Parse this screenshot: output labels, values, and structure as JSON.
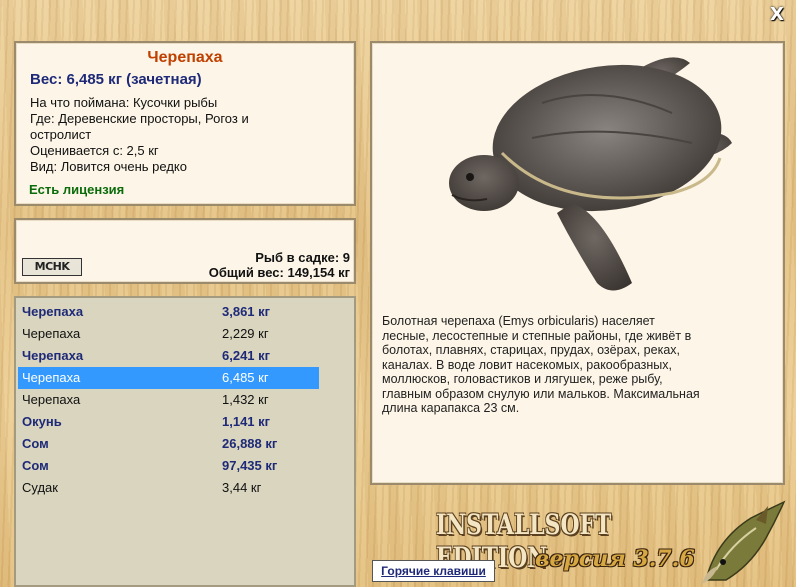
{
  "window": {
    "close_symbol": "X"
  },
  "info": {
    "title": "Черепаха",
    "weight": "Вес: 6,485 кг (зачетная)",
    "bait": "На что поймана: Кусочки рыбы",
    "where_line1": "Где: Деревенские просторы, Рогоз и",
    "where_line2": "остролист",
    "price": "Оценивается с: 2,5 кг",
    "kind": "Вид: Ловится очень редко",
    "license": "Есть лицензия"
  },
  "net": {
    "logo": "MCHK",
    "count_line": "Рыб в садке: 9",
    "total_line": "Общий вес: 149,154 кг"
  },
  "catch_list": [
    {
      "name": "Черепаха",
      "weight": "3,861 кг",
      "bold": true,
      "selected": false
    },
    {
      "name": "Черепаха",
      "weight": "2,229 кг",
      "bold": false,
      "selected": false
    },
    {
      "name": "Черепаха",
      "weight": "6,241 кг",
      "bold": true,
      "selected": false
    },
    {
      "name": "Черепаха",
      "weight": "6,485 кг",
      "bold": false,
      "selected": true
    },
    {
      "name": "Черепаха",
      "weight": "1,432 кг",
      "bold": false,
      "selected": false
    },
    {
      "name": "Окунь",
      "weight": "1,141 кг",
      "bold": true,
      "selected": false
    },
    {
      "name": "Сом",
      "weight": "26,888 кг",
      "bold": true,
      "selected": false
    },
    {
      "name": "Сом",
      "weight": "97,435 кг",
      "bold": true,
      "selected": false
    },
    {
      "name": "Судак",
      "weight": "3,44 кг",
      "bold": false,
      "selected": false
    }
  ],
  "description": {
    "lines": [
      "Болотная черепаха (Emys orbicularis) населяет",
      "лесные, лесостепные и степные районы, где живёт в",
      "болотах, плавнях, старицах, прудах, озёрах, реках,",
      "каналах. В воде ловит насекомых, ракообразных,",
      "моллюсков, головастиков и лягушек, реже рыбу,",
      "главным образом снулую или мальков. Максимальная",
      "длина карапакса 23 см."
    ]
  },
  "footer": {
    "brand": "INSTALLSOFT EDITION",
    "version": "версия 3.7.6",
    "hotkeys_label": "Горячие клавиши"
  },
  "colors": {
    "title": "#c04000",
    "accent_blue": "#1e2a78",
    "license_green": "#0a6b0a",
    "selection": "#3399ff"
  }
}
